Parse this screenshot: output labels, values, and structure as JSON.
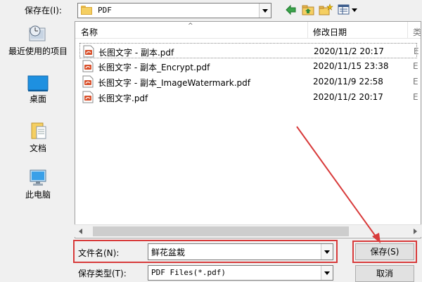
{
  "dialog": {
    "save_in_label": "保存在(I):",
    "save_in_value": "PDF"
  },
  "toolbar": {
    "back_icon": "back-arrow-icon",
    "up_icon": "up-folder-icon",
    "new_folder_icon": "new-folder-icon",
    "view_icon": "view-menu-icon"
  },
  "places": [
    {
      "label": "最近使用的项目",
      "icon": "recent-icon"
    },
    {
      "label": "桌面",
      "icon": "desktop-icon"
    },
    {
      "label": "文档",
      "icon": "documents-icon"
    },
    {
      "label": "此电脑",
      "icon": "computer-icon"
    }
  ],
  "columns": {
    "name": "名称",
    "date": "修改日期",
    "extra": "类"
  },
  "files": [
    {
      "name": "长图文字 - 副本.pdf",
      "date": "2020/11/2 20:17",
      "extra": "E"
    },
    {
      "name": "长图文字 - 副本_Encrypt.pdf",
      "date": "2020/11/15 23:38",
      "extra": "E"
    },
    {
      "name": "长图文字 - 副本_ImageWatermark.pdf",
      "date": "2020/11/9 22:58",
      "extra": "E"
    },
    {
      "name": "长图文字.pdf",
      "date": "2020/11/2 20:17",
      "extra": "E"
    }
  ],
  "filename": {
    "label": "文件名(N):",
    "value": "鲜花盆栽"
  },
  "filetype": {
    "label": "保存类型(T):",
    "value": "PDF Files(*.pdf)"
  },
  "buttons": {
    "save": "保存(S)",
    "cancel": "取消"
  },
  "colors": {
    "highlight": "#d83a3a",
    "pdf_icon": "#d9502b"
  }
}
